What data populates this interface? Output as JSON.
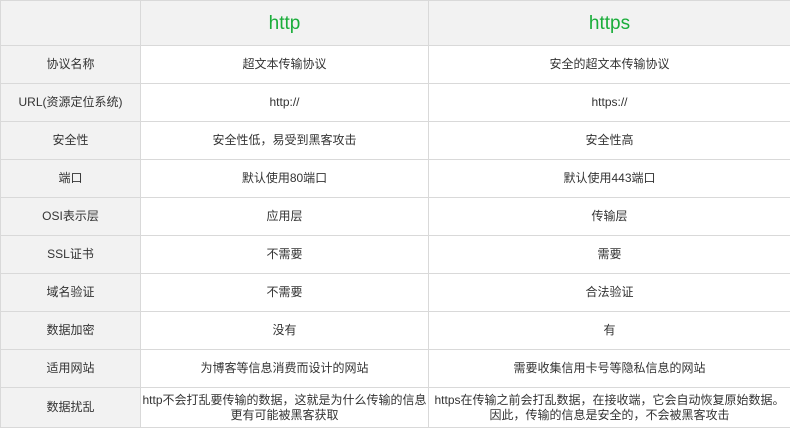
{
  "header": {
    "col0": "",
    "col1": "http",
    "col2": "https"
  },
  "accent_color": "#1aad3a",
  "rows": [
    {
      "label": "协议名称",
      "http": "超文本传输协议",
      "https": "安全的超文本传输协议"
    },
    {
      "label": "URL(资源定位系统)",
      "http": "http://",
      "https": "https://"
    },
    {
      "label": "安全性",
      "http": "安全性低，易受到黑客攻击",
      "https": "安全性高"
    },
    {
      "label": "端口",
      "http": "默认使用80端口",
      "https": "默认使用443端口"
    },
    {
      "label": "OSI表示层",
      "http": "应用层",
      "https": "传输层"
    },
    {
      "label": "SSL证书",
      "http": "不需要",
      "https": "需要"
    },
    {
      "label": "域名验证",
      "http": "不需要",
      "https": "合法验证"
    },
    {
      "label": "数据加密",
      "http": "没有",
      "https": "有"
    },
    {
      "label": "适用网站",
      "http": "为博客等信息消费而设计的网站",
      "https": "需要收集信用卡号等隐私信息的网站"
    },
    {
      "label": "数据扰乱",
      "http": "http不会打乱要传输的数据，这就是为什么传输的信息更有可能被黑客获取",
      "https": "https在传输之前会打乱数据，在接收端，它会自动恢复原始数据。因此，传输的信息是安全的，不会被黑客攻击"
    }
  ]
}
